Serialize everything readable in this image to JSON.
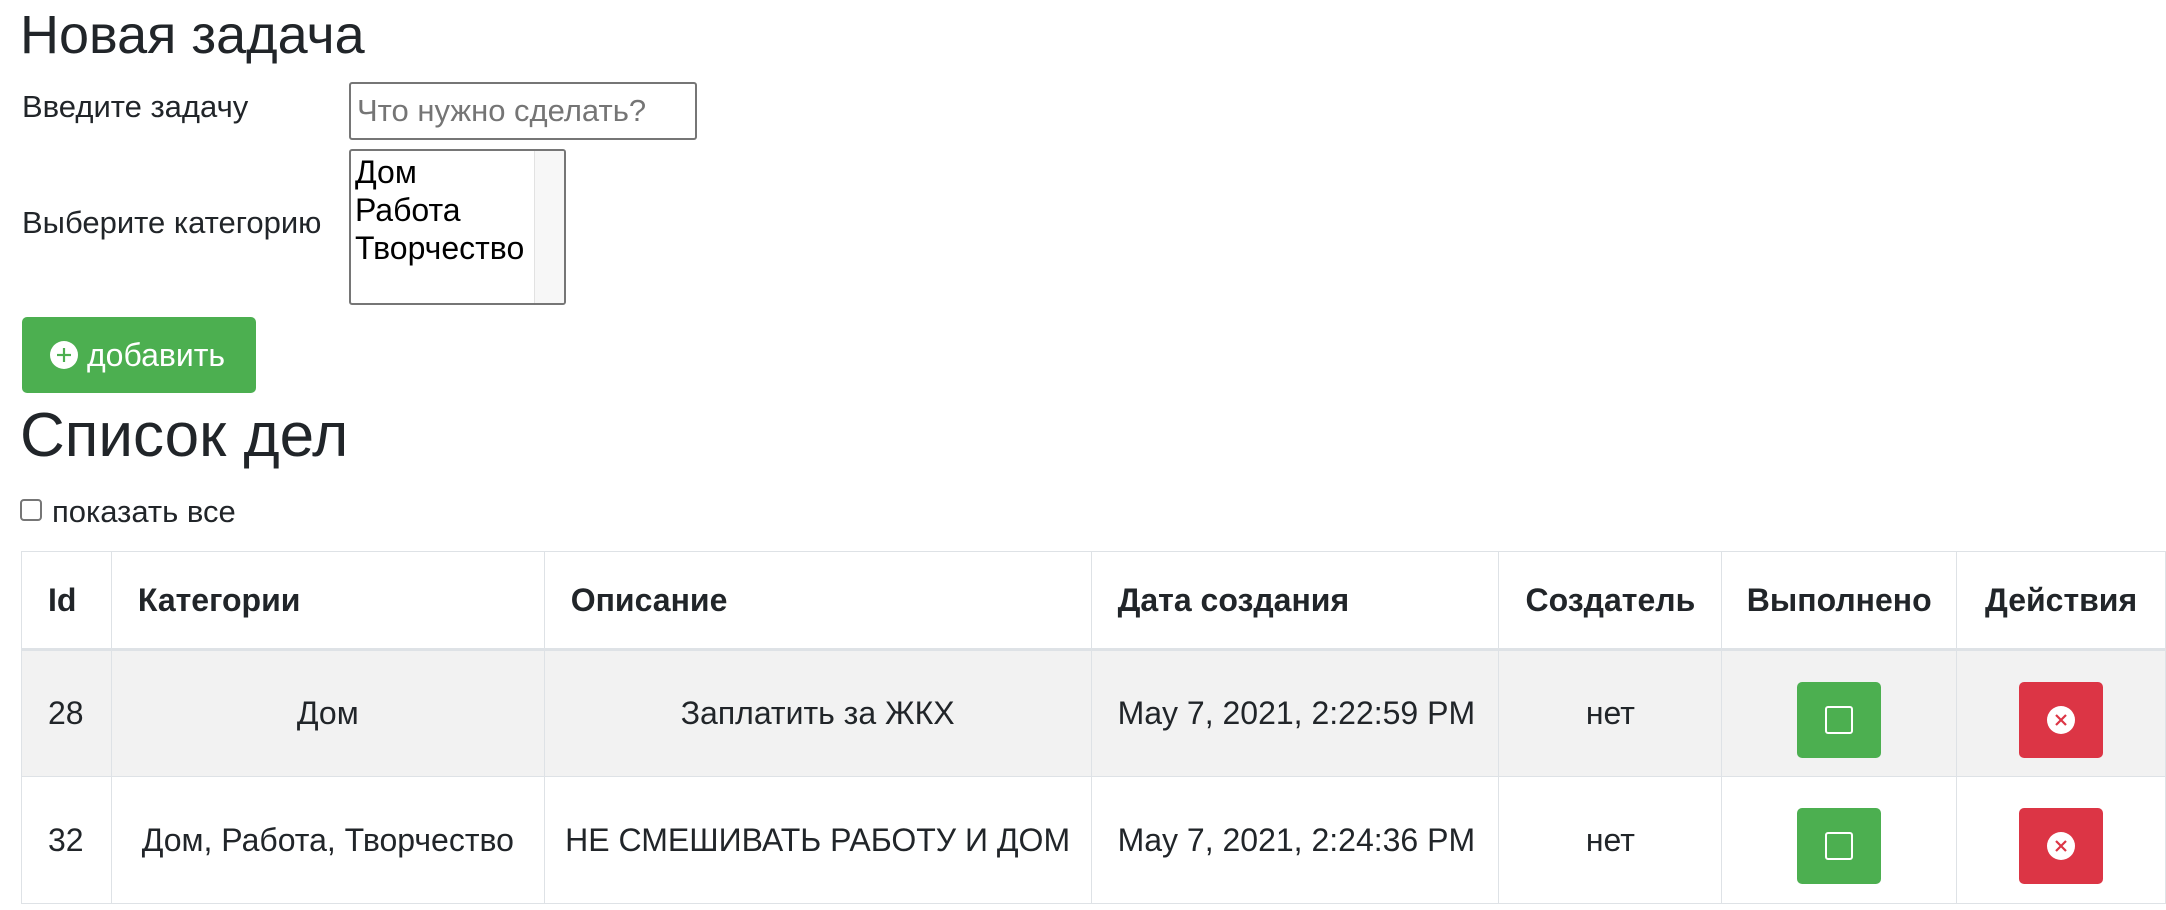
{
  "new_task": {
    "title": "Новая задача",
    "task_label": "Введите задачу",
    "task_placeholder": "Что нужно сделать?",
    "category_label": "Выберите категорию",
    "categories": [
      "Дом",
      "Работа",
      "Творчество"
    ],
    "add_button_label": "добавить",
    "add_button_icon": "plus-circle-icon"
  },
  "task_list": {
    "title": "Список дел",
    "show_all_label": "показать все",
    "show_all_checked": false,
    "columns": [
      "Id",
      "Категории",
      "Описание",
      "Дата создания",
      "Создатель",
      "Выполнено",
      "Действия"
    ],
    "rows": [
      {
        "id": "28",
        "categories": "Дом",
        "description": "Заплатить за ЖКХ",
        "created": "May 7, 2021, 2:22:59 PM",
        "creator": "нет"
      },
      {
        "id": "32",
        "categories": "Дом, Работа, Творчество",
        "description": "НЕ СМЕШИВАТЬ РАБОТУ И ДОМ",
        "created": "May 7, 2021, 2:24:36 PM",
        "creator": "нет"
      }
    ]
  },
  "colors": {
    "success": "#4caf50",
    "danger": "#dc3545",
    "striped_row": "#f2f2f2",
    "border": "#dee2e6"
  }
}
